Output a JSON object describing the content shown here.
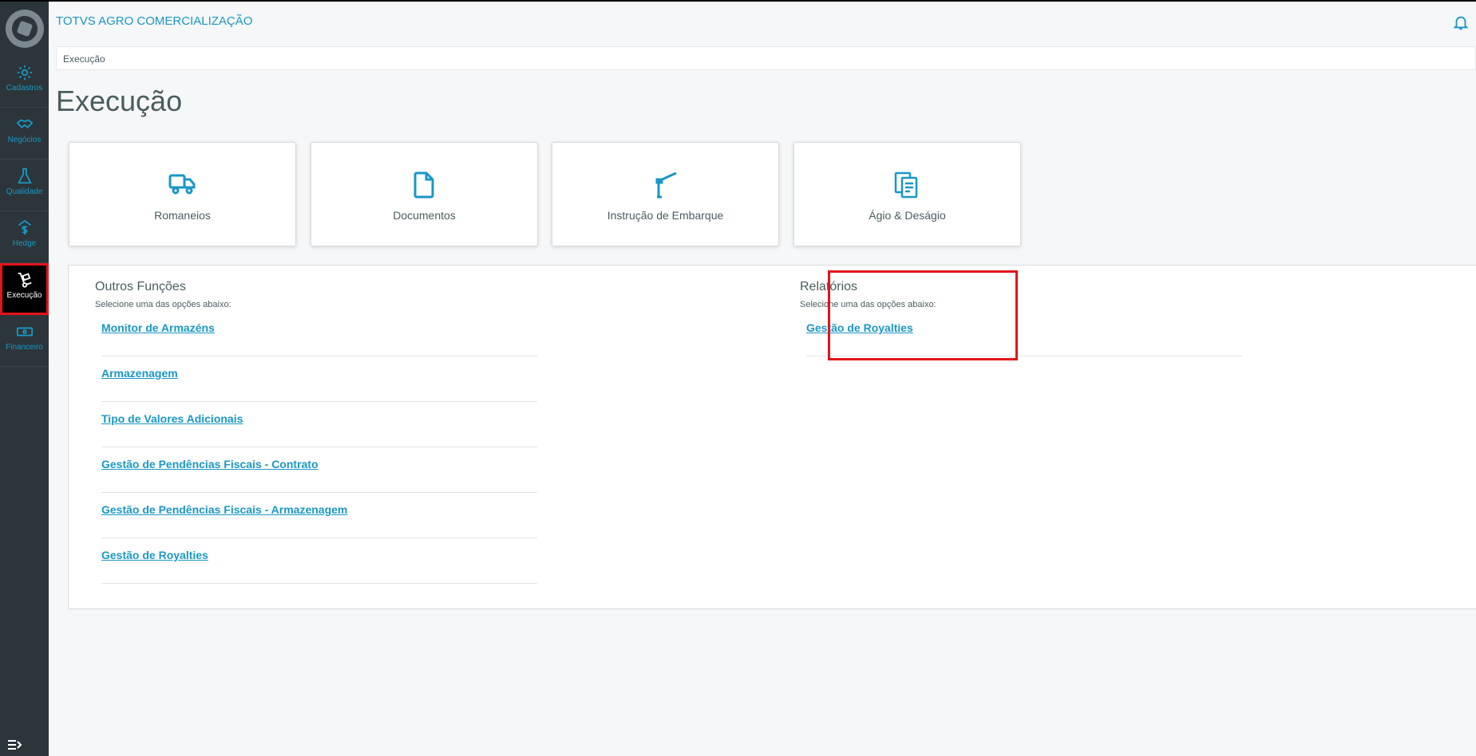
{
  "header": {
    "app_title": "TOTVS AGRO COMERCIALIZAÇÃO"
  },
  "sidebar": {
    "items": [
      {
        "label": "Cadastros",
        "icon": "gear-icon"
      },
      {
        "label": "Negócios",
        "icon": "handshake-icon"
      },
      {
        "label": "Qualidade",
        "icon": "flask-icon"
      },
      {
        "label": "Hedge",
        "icon": "dollar-shield-icon"
      },
      {
        "label": "Execução",
        "icon": "hand-truck-icon",
        "active": true
      },
      {
        "label": "Financeiro",
        "icon": "money-icon"
      }
    ]
  },
  "breadcrumb": "Execução",
  "page_title": "Execução",
  "cards": [
    {
      "label": "Romaneios",
      "icon": "truck-icon"
    },
    {
      "label": "Documentos",
      "icon": "document-icon"
    },
    {
      "label": "Instrução de Embarque",
      "icon": "crane-icon"
    },
    {
      "label": "Ágio & Deságio",
      "icon": "exchange-document-icon"
    }
  ],
  "outros": {
    "title": "Outros Funções",
    "subtitle": "Selecione uma das opções abaixo:",
    "links": [
      "Monitor de Armazéns",
      "Armazenagem",
      "Tipo de Valores Adicionais",
      "Gestão de Pendências Fiscais - Contrato",
      "Gestão de Pendências Fiscais - Armazenagem",
      "Gestão de Royalties"
    ]
  },
  "relatorios": {
    "title": "Relatórios",
    "subtitle": "Selecione uma das opções abaixo:",
    "links": [
      "Gestão de Royalties"
    ]
  },
  "colors": {
    "accent": "#1997c6",
    "sidebar_bg": "#2c3539",
    "highlight": "#e3131b"
  }
}
